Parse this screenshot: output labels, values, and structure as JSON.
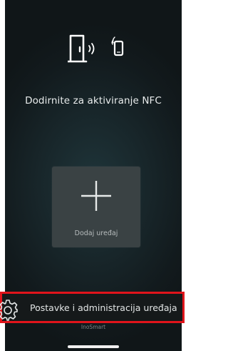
{
  "nfc_prompt": {
    "text": "Dodirnite za aktiviranje NFC",
    "icon": "nfc-door-phone-icon"
  },
  "add_device": {
    "label": "Dodaj uređaj",
    "icon": "plus-icon"
  },
  "settings": {
    "label": "Postavke i administracija uređaja",
    "icon": "gear-icon",
    "highlight_color": "#e0141b"
  },
  "footer": {
    "text": "InoSmart"
  },
  "colors": {
    "background": "#131c1f",
    "tile": "#3a4244",
    "text": "#e9ecec"
  }
}
